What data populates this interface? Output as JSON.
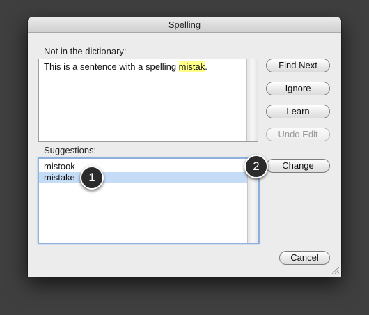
{
  "window": {
    "title": "Spelling"
  },
  "not_in_dictionary": {
    "label": "Not in the dictionary:",
    "sentence_before": "This is a sentence with a spelling ",
    "misspelled_word": "mistak",
    "sentence_after": "."
  },
  "suggestions": {
    "label": "Suggestions:",
    "items": [
      "mistook",
      "mistake"
    ],
    "selected": "mistake"
  },
  "buttons": {
    "find_next": "Find Next",
    "ignore": "Ignore",
    "learn": "Learn",
    "undo_edit": "Undo Edit",
    "change": "Change",
    "cancel": "Cancel"
  },
  "callouts": {
    "one": "1",
    "two": "2"
  },
  "colors": {
    "highlight": "#ffff88",
    "selection": "#c5dcf6",
    "focus_ring": "#8fb0dd"
  }
}
